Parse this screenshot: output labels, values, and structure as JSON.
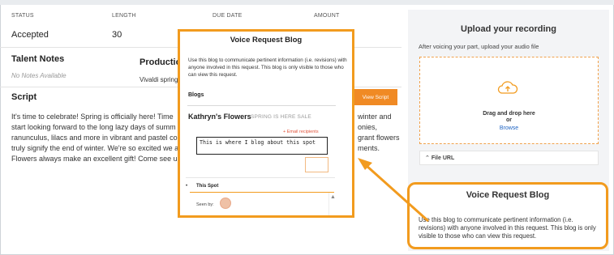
{
  "details": {
    "status_label": "STATUS",
    "status_value": "Accepted",
    "length_label": "LENGTH",
    "length_value": "30",
    "due_label": "DUE DATE",
    "amount_label": "AMOUNT"
  },
  "talent_notes": {
    "title": "Talent Notes",
    "empty": "No Notes Available"
  },
  "production": {
    "title": "Productio",
    "text": "Vivaldi spring"
  },
  "script": {
    "title": "Script",
    "lines": [
      "It's time to celebrate! Spring is officially here! Time",
      "start looking forward to the long lazy days of summ",
      "ranunculus, lilacs and more in vibrant and pastel col",
      "truly signify the end of winter. We're so excited we a",
      "Flowers always make an excellent gift! Come see u"
    ],
    "right_fragments": [
      "winter and",
      "onies,",
      "grant flowers",
      "ments."
    ]
  },
  "view_script_button": "View Script",
  "upload": {
    "title": "Upload your recording",
    "subtitle": "After voicing your part, upload your audio file",
    "drag_text": "Drag and drop here",
    "or_text": "or",
    "browse_text": "Browse",
    "file_url_label": "File URL"
  },
  "blog_popup": {
    "title": "Voice Request Blog",
    "description": "Use this blog to communicate pertinent information (i.e. revisions) with anyone involved in this request. This blog is only visible to those who can view this request.",
    "blogs_label": "Blogs",
    "blog_name": "Kathryn's Flowers",
    "blog_tag": "SPRING IS HERE SALE",
    "email_recipients": "Email recipients",
    "textarea_value": "This is where I blog about this spot",
    "entry_title": "This Spot",
    "seen_by": "Seen by:"
  },
  "callout": {
    "title": "Voice Request Blog",
    "description": "Use this blog to communicate pertinent information (i.e. revisions) with anyone involved in this request. This blog is only visible to those who can view this request."
  },
  "colors": {
    "accent": "#f29b1e",
    "button": "#f08a24",
    "link": "#2166c4",
    "email": "#e0533a"
  },
  "icons": [
    "cloud-upload-icon",
    "chevron-up-icon",
    "arrow-icon",
    "scroll-up-icon"
  ]
}
